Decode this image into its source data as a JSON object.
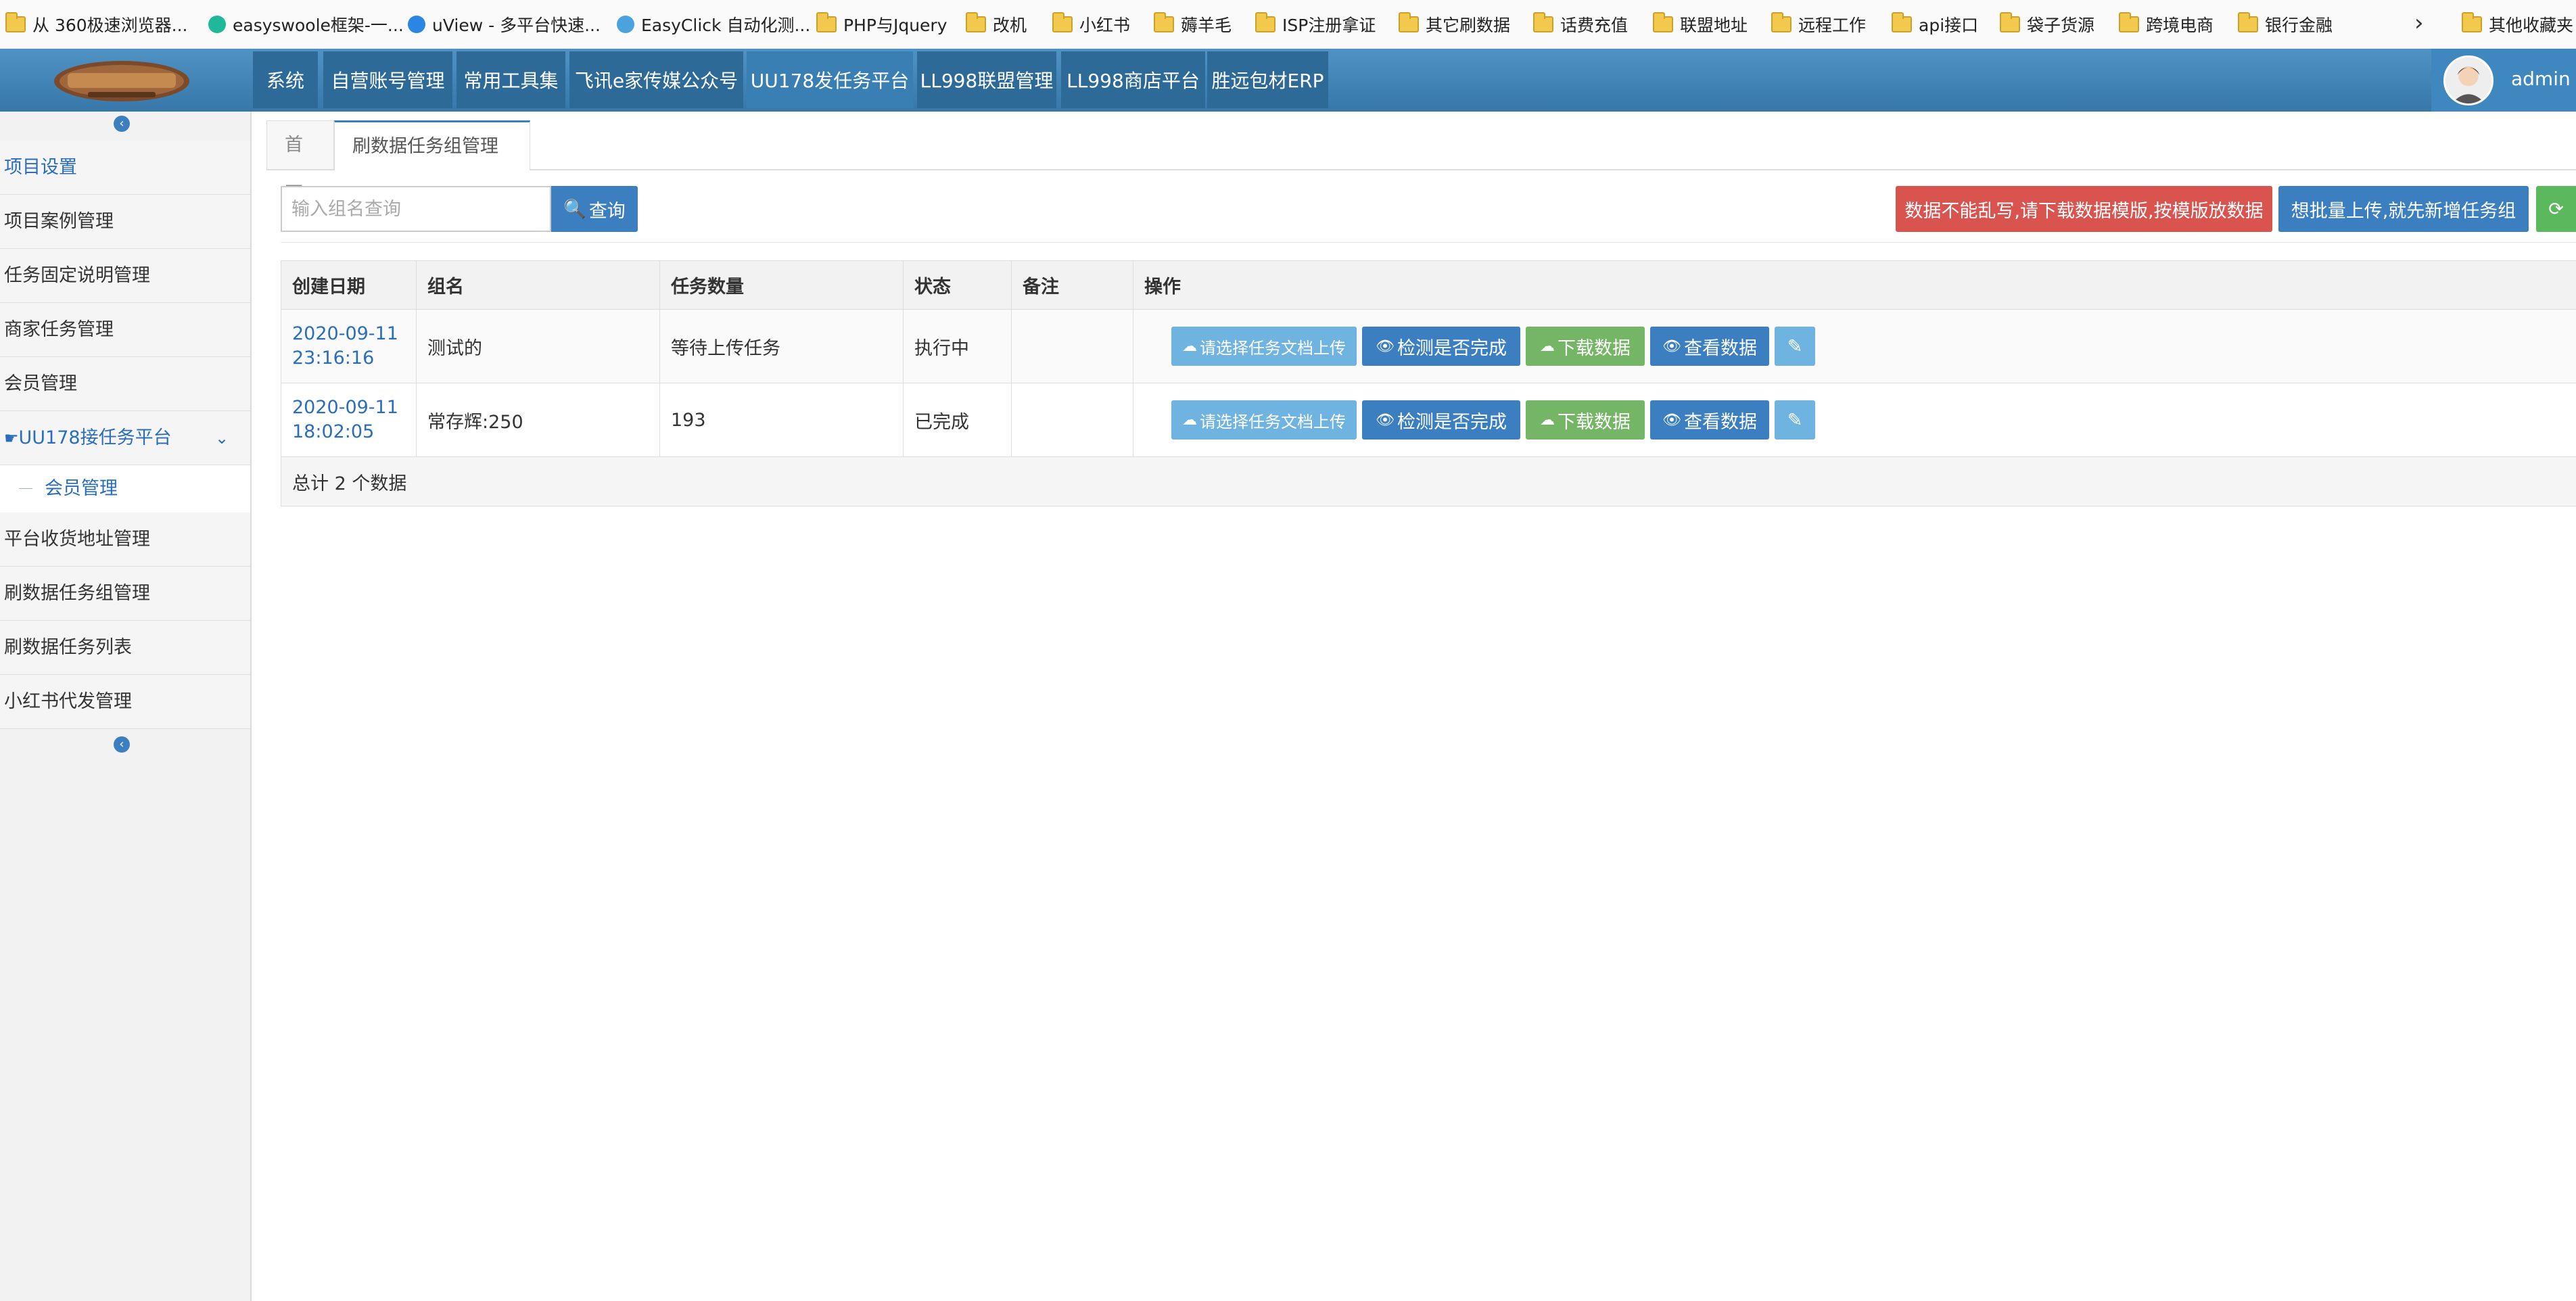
{
  "bookmarks": [
    {
      "label": "从 360极速浏览器...",
      "icon": "folder-icon"
    },
    {
      "label": "easyswoole框架-一...",
      "icon": "easyswoole-logo-icon"
    },
    {
      "label": "uView - 多平台快速...",
      "icon": "uview-logo-icon"
    },
    {
      "label": "EasyClick 自动化测...",
      "icon": "easyclick-logo-icon"
    },
    {
      "label": "PHP与Jquery",
      "icon": "folder-icon"
    },
    {
      "label": "改机",
      "icon": "folder-icon"
    },
    {
      "label": "小红书",
      "icon": "folder-icon"
    },
    {
      "label": "薅羊毛",
      "icon": "folder-icon"
    },
    {
      "label": "ISP注册拿证",
      "icon": "folder-icon"
    },
    {
      "label": "其它刷数据",
      "icon": "folder-icon"
    },
    {
      "label": "话费充值",
      "icon": "folder-icon"
    },
    {
      "label": "联盟地址",
      "icon": "folder-icon"
    },
    {
      "label": "远程工作",
      "icon": "folder-icon"
    },
    {
      "label": "api接口",
      "icon": "folder-icon"
    },
    {
      "label": "袋子货源",
      "icon": "folder-icon"
    },
    {
      "label": "跨境电商",
      "icon": "folder-icon"
    },
    {
      "label": "银行金融",
      "icon": "folder-icon"
    },
    {
      "label": "其他收藏夹",
      "icon": "folder-icon"
    }
  ],
  "topnav": {
    "tabs": [
      "系统",
      "自营账号管理",
      "常用工具集",
      "飞讯e家传媒公众号",
      "UU178发任务平台",
      "LL998联盟管理",
      "LL998商店平台",
      "胜远包材ERP"
    ],
    "active_index": 4,
    "username": "admin",
    "colors": {
      "bar": "#3a7fb3",
      "tab": "#2e6a98",
      "active": "#3a7fb3"
    }
  },
  "sidebar": {
    "items": [
      "项目设置",
      "项目案例管理",
      "任务固定说明管理",
      "商家任务管理",
      "会员管理",
      "UU178接任务平台",
      "平台收货地址管理",
      "刷数据任务组管理",
      "刷数据任务列表",
      "小红书代发管理"
    ],
    "expanded_label": "UU178接任务平台",
    "sub_item": "会员管理",
    "collapse_icon": "chevron-circle-left-icon"
  },
  "content_tabs": [
    {
      "label": "首页",
      "active": false
    },
    {
      "label": "刷数据任务组管理",
      "active": true
    }
  ],
  "toolbar": {
    "search_placeholder": "输入组名查询",
    "query_label": "查询",
    "template_warning_label": "数据不能乱写,请下载数据模版,按模版放数据",
    "add_group_label": "想批量上传,就先新增任务组",
    "colors": {
      "primary": "#3b7fc0",
      "danger": "#d9534f",
      "success": "#5cb85c"
    }
  },
  "table": {
    "headers": [
      "创建日期",
      "组名",
      "任务数量",
      "状态",
      "备注",
      "操作"
    ],
    "rows": [
      {
        "date": "2020-09-11",
        "time": "23:16:16",
        "name": "测试的",
        "count": "等待上传任务",
        "status": "执行中",
        "remark": ""
      },
      {
        "date": "2020-09-11",
        "time": "18:02:05",
        "name": "常存辉:250",
        "count": "193",
        "status": "已完成",
        "remark": ""
      }
    ],
    "actions": {
      "upload": "请选择任务文档上传",
      "check": "检测是否完成",
      "download": "下载数据",
      "view": "查看数据"
    },
    "footer": "总计 2 个数据"
  }
}
